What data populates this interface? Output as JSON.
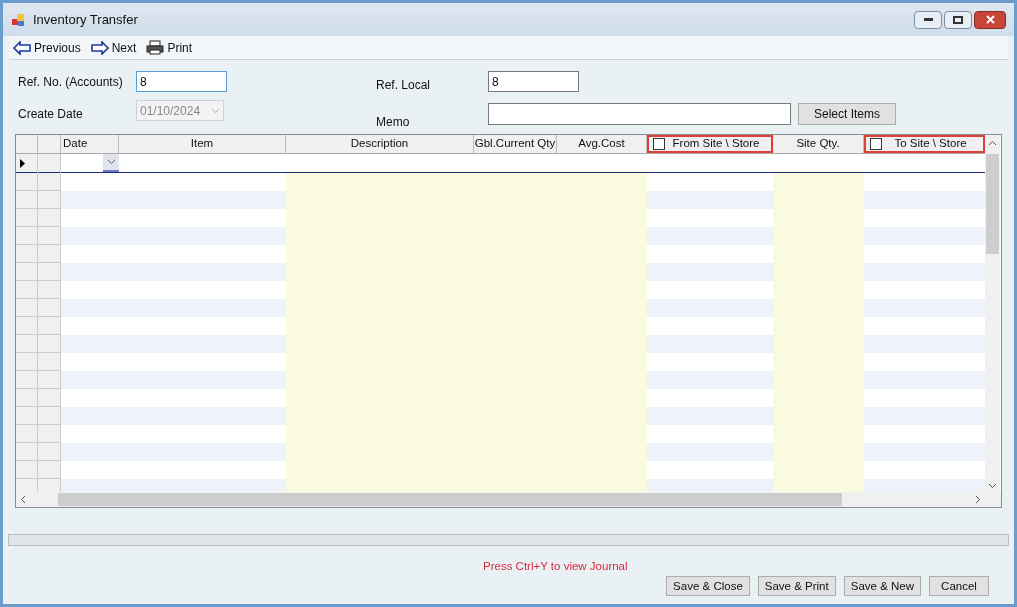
{
  "window": {
    "title": "Inventory Transfer"
  },
  "toolbar": [
    {
      "kind": "previous",
      "label": "Previous"
    },
    {
      "kind": "next",
      "label": "Next"
    },
    {
      "kind": "print",
      "label": "Print"
    }
  ],
  "form": {
    "ref_no": {
      "label": "Ref. No. (Accounts)",
      "value": "8"
    },
    "create_date": {
      "label": "Create Date",
      "value": "01/10/2024",
      "disabled": true
    },
    "ref_local": {
      "label": "Ref. Local",
      "value": "8"
    },
    "memo": {
      "label": "Memo"
    },
    "select_items": "Select Items"
  },
  "grid": {
    "columns": [
      {
        "label": "Date",
        "kind": "text",
        "shaded": false,
        "highlighted": false
      },
      {
        "label": "Item",
        "kind": "text",
        "shaded": false,
        "highlighted": false
      },
      {
        "label": "Description",
        "kind": "text",
        "shaded": true,
        "highlighted": false
      },
      {
        "label": "Gbl.Current Qty",
        "kind": "text",
        "shaded": true,
        "highlighted": false
      },
      {
        "label": "Avg.Cost",
        "kind": "text",
        "shaded": true,
        "highlighted": false
      },
      {
        "label": "From Site \\ Store",
        "kind": "checkbox",
        "checked": false,
        "shaded": false,
        "highlighted": true
      },
      {
        "label": "Site Qty.",
        "kind": "text",
        "shaded": true,
        "highlighted": false
      },
      {
        "label": "To Site \\ Store",
        "kind": "checkbox",
        "checked": false,
        "shaded": false,
        "highlighted": true
      }
    ]
  },
  "hint": "Press Ctrl+Y to view Journal",
  "buttons": [
    "Save & Close",
    "Save & Print",
    "Save & New",
    "Cancel"
  ]
}
